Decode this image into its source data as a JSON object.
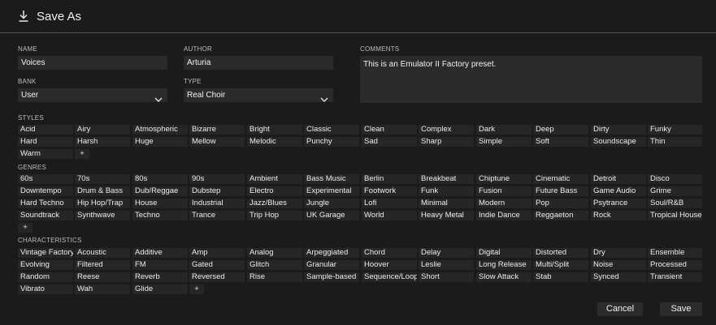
{
  "title": "Save As",
  "labels": {
    "name": "NAME",
    "author": "AUTHOR",
    "comments": "COMMENTS",
    "bank": "BANK",
    "type": "TYPE",
    "styles": "STYLES",
    "genres": "GENRES",
    "characteristics": "CHARACTERISTICS"
  },
  "fields": {
    "name": "Voices",
    "author": "Arturia",
    "comments": "This is an Emulator II Factory preset.",
    "bank": "User",
    "type": "Real Choir"
  },
  "styles": [
    "Acid",
    "Airy",
    "Atmospheric",
    "Bizarre",
    "Bright",
    "Classic",
    "Clean",
    "Complex",
    "Dark",
    "Deep",
    "Dirty",
    "Funky",
    "Hard",
    "Harsh",
    "Huge",
    "Mellow",
    "Melodic",
    "Punchy",
    "Sad",
    "Sharp",
    "Simple",
    "Soft",
    "Soundscape",
    "Thin",
    "Warm"
  ],
  "genres": [
    "60s",
    "70s",
    "80s",
    "90s",
    "Ambient",
    "Bass Music",
    "Berlin",
    "Breakbeat",
    "Chiptune",
    "Cinematic",
    "Detroit",
    "Disco",
    "Downtempo",
    "Drum & Bass",
    "Dub/Reggae",
    "Dubstep",
    "Electro",
    "Experimental",
    "Footwork",
    "Funk",
    "Fusion",
    "Future Bass",
    "Game Audio",
    "Grime",
    "Hard Techno",
    "Hip Hop/Trap",
    "House",
    "Industrial",
    "Jazz/Blues",
    "Jungle",
    "Lofi",
    "Minimal",
    "Modern",
    "Pop",
    "Psytrance",
    "Soul/R&B",
    "Soundtrack",
    "Synthwave",
    "Techno",
    "Trance",
    "Trip Hop",
    "UK Garage",
    "World",
    "Heavy Metal",
    "Indie Dance",
    "Reggaeton",
    "Rock",
    "Tropical House"
  ],
  "characteristics": [
    "Vintage Factory",
    "Acoustic",
    "Additive",
    "Amp",
    "Analog",
    "Arpeggiated",
    "Chord",
    "Delay",
    "Digital",
    "Distorted",
    "Dry",
    "Ensemble",
    "Evolving",
    "Filtered",
    "FM",
    "Gated",
    "Glitch",
    "Granular",
    "Hoover",
    "Leslie",
    "Long Release",
    "Multi/Split",
    "Noise",
    "Processed",
    "Random",
    "Reese",
    "Reverb",
    "Reversed",
    "Rise",
    "Sample-based",
    "Sequence/Loop",
    "Short",
    "Slow Attack",
    "Stab",
    "Synced",
    "Transient",
    "Vibrato",
    "Wah",
    "Glide"
  ],
  "add_label": "+",
  "buttons": {
    "cancel": "Cancel",
    "save": "Save"
  },
  "icons": {
    "title": "download-icon",
    "dropdown": "chevron-down-icon"
  },
  "colors": {
    "background": "#1b1b1b",
    "tag_background": "#262626",
    "field_background": "#2b2b2b"
  }
}
